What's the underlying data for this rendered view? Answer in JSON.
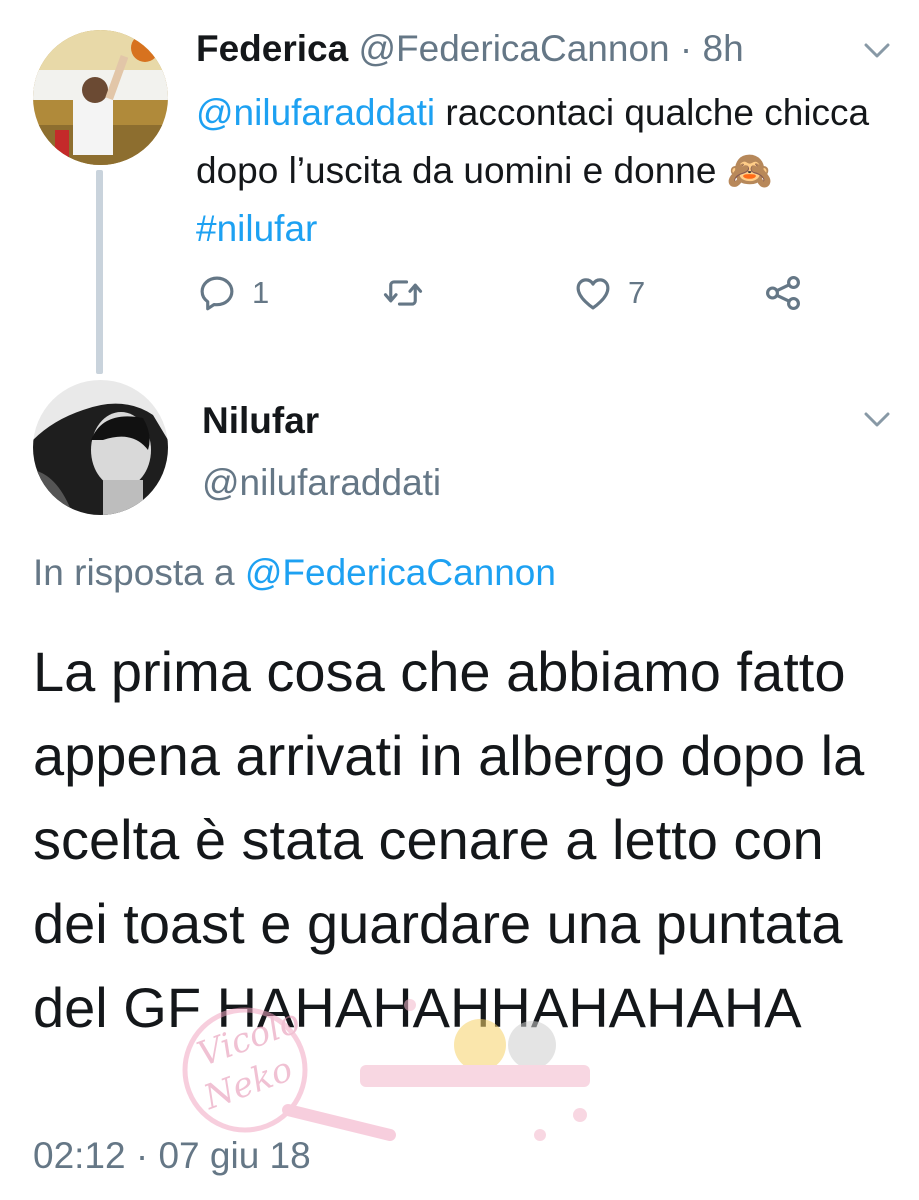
{
  "colors": {
    "accent": "#1da1f2",
    "muted": "#657786",
    "text": "#14171a",
    "thread_line": "#c9d3dc"
  },
  "tweet1": {
    "avatar_icon": "user-avatar-basketball",
    "name": "Federica",
    "handle": "@FedericaCannon",
    "separator": "·",
    "time": "8h",
    "text_mention": "@nilufaraddati",
    "text_body": " raccontaci qualche chicca dopo l’uscita da uomini e donne ",
    "emoji": "🙈",
    "hashtag": "#nilufar",
    "actions": {
      "reply_icon": "reply-icon",
      "reply_count": "1",
      "retweet_icon": "retweet-icon",
      "retweet_count": "",
      "like_icon": "heart-icon",
      "like_count": "7",
      "share_icon": "share-icon"
    },
    "menu_icon": "chevron-down-icon"
  },
  "tweet2": {
    "avatar_icon": "user-avatar-portrait",
    "name": "Nilufar",
    "handle": "@nilufaraddati",
    "menu_icon": "chevron-down-icon",
    "reply_prefix": "In risposta a ",
    "reply_to": "@FedericaCannon",
    "text": "La prima cosa che abbiamo fatto appena arrivati in albergo dopo la scelta è stata cenare a letto con dei toast e guardare una puntata del GF HAHAHAHHAHAHAHA",
    "timestamp": "02:12 · 07 giu 18"
  },
  "watermark": {
    "text": "Vicolo Neko"
  }
}
